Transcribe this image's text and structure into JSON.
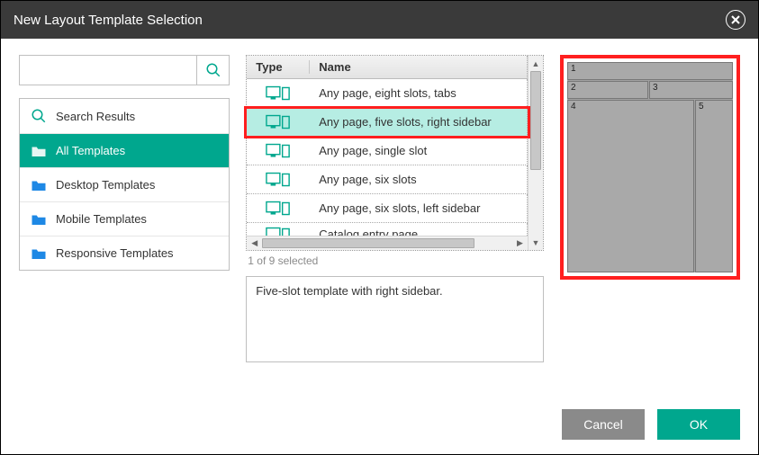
{
  "window": {
    "title": "New Layout Template Selection"
  },
  "search": {
    "placeholder": ""
  },
  "categories": {
    "items": [
      {
        "label": "Search Results",
        "kind": "search",
        "selected": false
      },
      {
        "label": "All Templates",
        "kind": "folder",
        "selected": true
      },
      {
        "label": "Desktop Templates",
        "kind": "folder",
        "selected": false
      },
      {
        "label": "Mobile Templates",
        "kind": "folder",
        "selected": false
      },
      {
        "label": "Responsive Templates",
        "kind": "folder",
        "selected": false
      }
    ]
  },
  "table": {
    "headers": {
      "type": "Type",
      "name": "Name"
    },
    "rows": [
      {
        "name": "Any page, eight slots, tabs",
        "selected": false
      },
      {
        "name": "Any page, five slots, right sidebar",
        "selected": true
      },
      {
        "name": "Any page, single slot",
        "selected": false
      },
      {
        "name": "Any page, six slots",
        "selected": false
      },
      {
        "name": "Any page, six slots, left sidebar",
        "selected": false
      },
      {
        "name": "Catalog entry page",
        "selected": false
      }
    ],
    "status": "1 of 9 selected"
  },
  "description": "Five-slot template with right sidebar.",
  "preview": {
    "cells": {
      "c1": "1",
      "c2": "2",
      "c3": "3",
      "c4": "4",
      "c5": "5"
    }
  },
  "footer": {
    "cancel": "Cancel",
    "ok": "OK"
  }
}
